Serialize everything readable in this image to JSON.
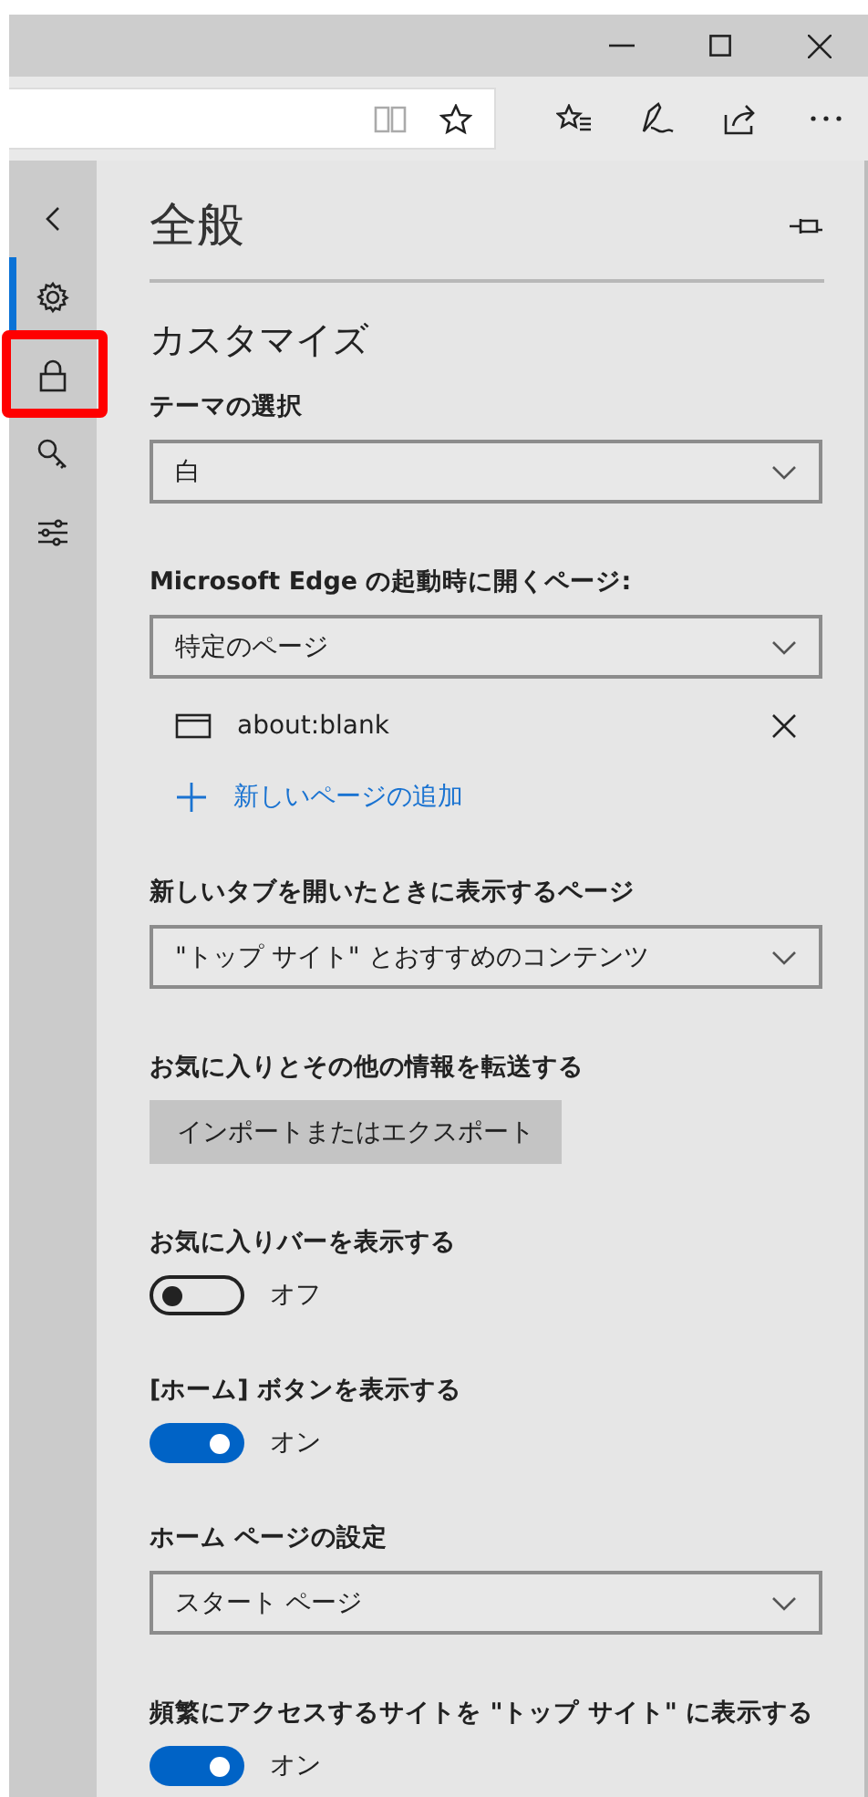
{
  "sidebar": {
    "items": [
      {
        "kind": "back",
        "selected": false,
        "highlighted": false
      },
      {
        "kind": "general",
        "selected": true,
        "highlighted": false
      },
      {
        "kind": "privacy",
        "selected": false,
        "highlighted": true
      },
      {
        "kind": "passwords",
        "selected": false,
        "highlighted": false
      },
      {
        "kind": "advanced",
        "selected": false,
        "highlighted": false
      }
    ]
  },
  "panel": {
    "title": "全般",
    "section": "カスタマイズ",
    "settings": [
      {
        "kind": "dropdown",
        "label": "テーマの選択",
        "value": "白"
      },
      {
        "kind": "dropdown",
        "label": "Microsoft Edge の起動時に開くページ:",
        "value": "特定のページ",
        "pages": [
          {
            "url": "about:blank"
          }
        ],
        "add_link": "新しいページの追加"
      },
      {
        "kind": "dropdown",
        "label": "新しいタブを開いたときに表示するページ",
        "value": "\"トップ サイト\" とおすすめのコンテンツ"
      },
      {
        "kind": "button",
        "label": "お気に入りとその他の情報を転送する",
        "button": "インポートまたはエクスポート"
      },
      {
        "kind": "toggle",
        "label": "お気に入りバーを表示する",
        "on": false,
        "state_text": "オフ"
      },
      {
        "kind": "toggle",
        "label": "[ホーム] ボタンを表示する",
        "on": true,
        "state_text": "オン"
      },
      {
        "kind": "dropdown",
        "label": "ホーム ページの設定",
        "value": "スタート ページ"
      },
      {
        "kind": "toggle",
        "label": "頻繁にアクセスするサイトを \"トップ サイト\" に表示する",
        "on": true,
        "state_text": "オン"
      }
    ]
  }
}
